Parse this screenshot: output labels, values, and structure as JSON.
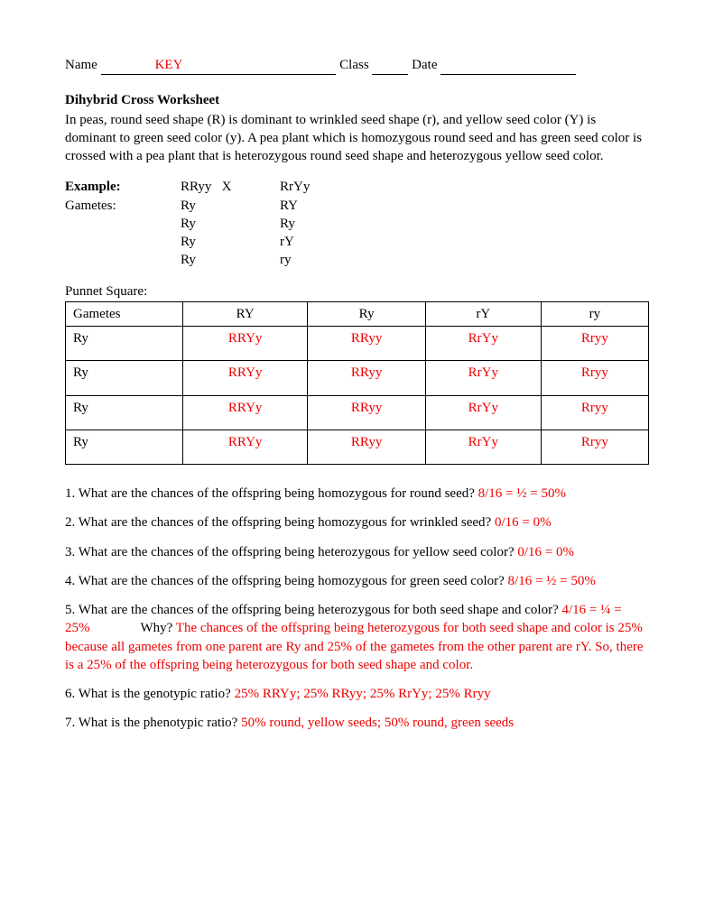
{
  "header": {
    "name_label": "Name",
    "name_value": "KEY",
    "class_label": "Class",
    "date_label": "Date"
  },
  "title": "Dihybrid Cross Worksheet",
  "intro": "In peas, round seed shape (R) is dominant to wrinkled seed shape (r), and yellow seed color (Y) is dominant to green seed color (y). A pea plant which is homozygous round seed and has green seed color is crossed with a pea plant that is heterozygous round seed shape and heterozygous yellow seed color.",
  "example": {
    "label_example": "Example:",
    "label_gametes": "Gametes:",
    "col1": [
      "RRyy   X",
      "Ry",
      "Ry",
      "Ry",
      "Ry"
    ],
    "col2": [
      "RrYy",
      "RY",
      "Ry",
      "rY",
      "ry"
    ]
  },
  "punnett": {
    "label": "Punnet Square:",
    "corner": "Gametes",
    "cols": [
      "RY",
      "Ry",
      "rY",
      "ry"
    ],
    "rows": [
      {
        "label": "Ry",
        "cells": [
          "RRYy",
          "RRyy",
          "RrYy",
          "Rryy"
        ]
      },
      {
        "label": "Ry",
        "cells": [
          "RRYy",
          "RRyy",
          "RrYy",
          "Rryy"
        ]
      },
      {
        "label": "Ry",
        "cells": [
          "RRYy",
          "RRyy",
          "RrYy",
          "Rryy"
        ]
      },
      {
        "label": "Ry",
        "cells": [
          "RRYy",
          "RRyy",
          "RrYy",
          "Rryy"
        ]
      }
    ]
  },
  "questions": {
    "q1": {
      "text": "1. What are the chances of the offspring being homozygous for round seed? ",
      "ans": "8/16 = ½ = 50%"
    },
    "q2": {
      "text": "2. What are the chances of the offspring being homozygous for wrinkled seed? ",
      "ans": "0/16 = 0%"
    },
    "q3": {
      "text": "3. What are the chances of the offspring being heterozygous for yellow seed color? ",
      "ans": "0/16 = 0%"
    },
    "q4": {
      "text": "4. What are the chances of the offspring being homozygous for green seed color? ",
      "ans": "8/16 = ½ = 50%"
    },
    "q5": {
      "text1": "5. What are the chances of the offspring being heterozygous for both seed shape and color? ",
      "ans1": "4/16 = ¼ = 25%",
      "why_label": "Why? ",
      "ans2": "The chances of the offspring being heterozygous for both seed shape and color is 25% because all gametes from one parent are Ry and 25% of the gametes from the other parent are rY.  So, there is a 25% of the offspring being heterozygous for both seed shape and color."
    },
    "q6": {
      "text": "6. What is the genotypic ratio? ",
      "ans": "25% RRYy; 25% RRyy; 25% RrYy; 25% Rryy"
    },
    "q7": {
      "text": "7. What is the phenotypic ratio? ",
      "ans": "50% round, yellow seeds; 50% round, green seeds"
    }
  }
}
